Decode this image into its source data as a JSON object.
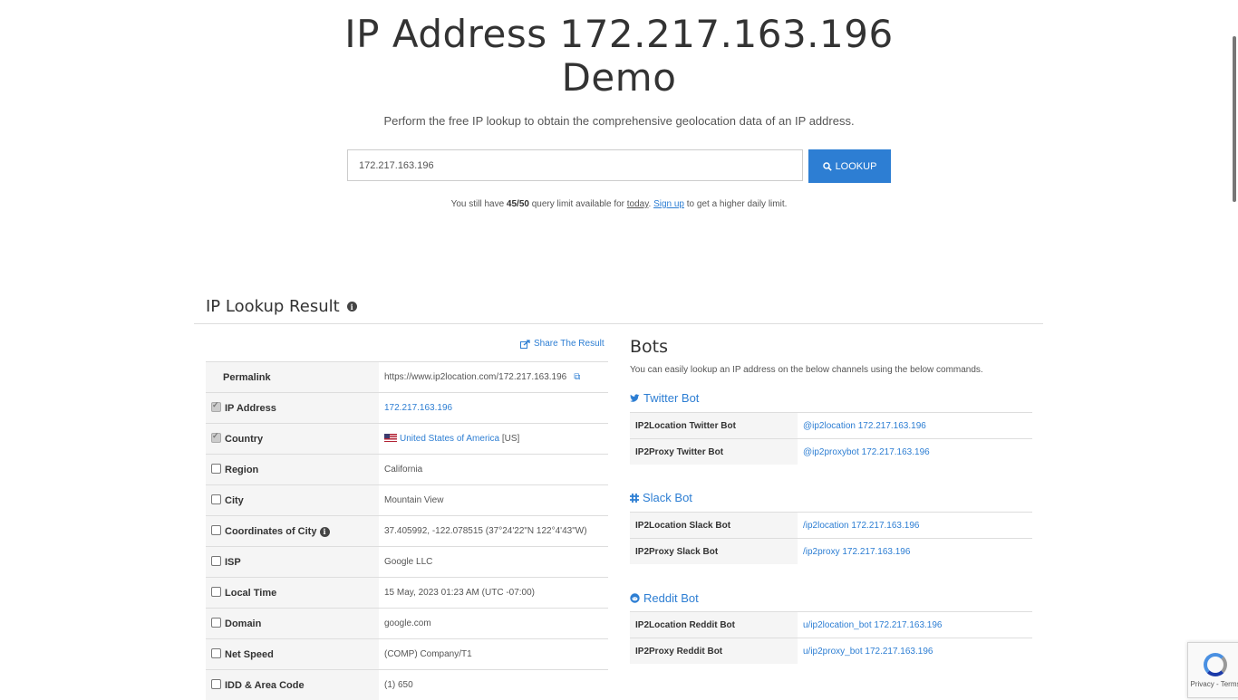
{
  "hero": {
    "title_line1": "IP Address 172.217.163.196",
    "title_line2": "Demo",
    "subtitle": "Perform the free IP lookup to obtain the comprehensive geolocation data of an IP address."
  },
  "search": {
    "value": "172.217.163.196",
    "button_label": "LOOKUP",
    "button_icon": "search-icon"
  },
  "quota": {
    "prefix": "You still have",
    "count": "45/50",
    "middle": "query limit available for",
    "today_link": "today",
    "dot": ".",
    "signup_link": "Sign up",
    "suffix": "to get a higher daily limit."
  },
  "result": {
    "title": "IP Lookup Result",
    "share_label": "Share The Result",
    "rows": [
      {
        "label": "Permalink",
        "value": "https://www.ip2location.com/172.217.163.196",
        "checkbox": "none"
      },
      {
        "label": "IP Address",
        "value": "172.217.163.196",
        "checkbox": "checked"
      },
      {
        "label": "Country",
        "value": "United States of America",
        "extra": "[US]",
        "checkbox": "checked"
      },
      {
        "label": "Region",
        "value": "California",
        "checkbox": "unchecked"
      },
      {
        "label": "City",
        "value": "Mountain View",
        "checkbox": "unchecked"
      },
      {
        "label": "Coordinates of City",
        "value": "37.405992, -122.078515 (37°24'22\"N   122°4'43\"W)",
        "checkbox": "unchecked"
      },
      {
        "label": "ISP",
        "value": "Google LLC",
        "checkbox": "unchecked"
      },
      {
        "label": "Local Time",
        "value": "15 May, 2023 01:23 AM (UTC -07:00)",
        "checkbox": "unchecked"
      },
      {
        "label": "Domain",
        "value": "google.com",
        "checkbox": "unchecked"
      },
      {
        "label": "Net Speed",
        "value": "(COMP) Company/T1",
        "checkbox": "unchecked"
      },
      {
        "label": "IDD & Area Code",
        "value": "(1) 650",
        "checkbox": "unchecked"
      }
    ]
  },
  "bots": {
    "title": "Bots",
    "description": "You can easily lookup an IP address on the below channels using the below commands.",
    "groups": [
      {
        "name": "Twitter Bot",
        "icon": "twitter-icon",
        "rows": [
          {
            "label": "IP2Location Twitter Bot",
            "value": "@ip2location 172.217.163.196"
          },
          {
            "label": "IP2Proxy Twitter Bot",
            "value": "@ip2proxybot 172.217.163.196"
          }
        ]
      },
      {
        "name": "Slack Bot",
        "icon": "slack-icon",
        "rows": [
          {
            "label": "IP2Location Slack Bot",
            "value": "/ip2location 172.217.163.196"
          },
          {
            "label": "IP2Proxy Slack Bot",
            "value": "/ip2proxy 172.217.163.196"
          }
        ]
      },
      {
        "name": "Reddit Bot",
        "icon": "reddit-icon",
        "rows": [
          {
            "label": "IP2Location Reddit Bot",
            "value": "u/ip2location_bot 172.217.163.196"
          },
          {
            "label": "IP2Proxy Reddit Bot",
            "value": "u/ip2proxy_bot 172.217.163.196"
          }
        ]
      }
    ]
  },
  "recaptcha": {
    "label": "Privacy - Terms"
  },
  "colors": {
    "accent": "#2d7ed3",
    "text": "#333333",
    "border": "#dddddd"
  }
}
